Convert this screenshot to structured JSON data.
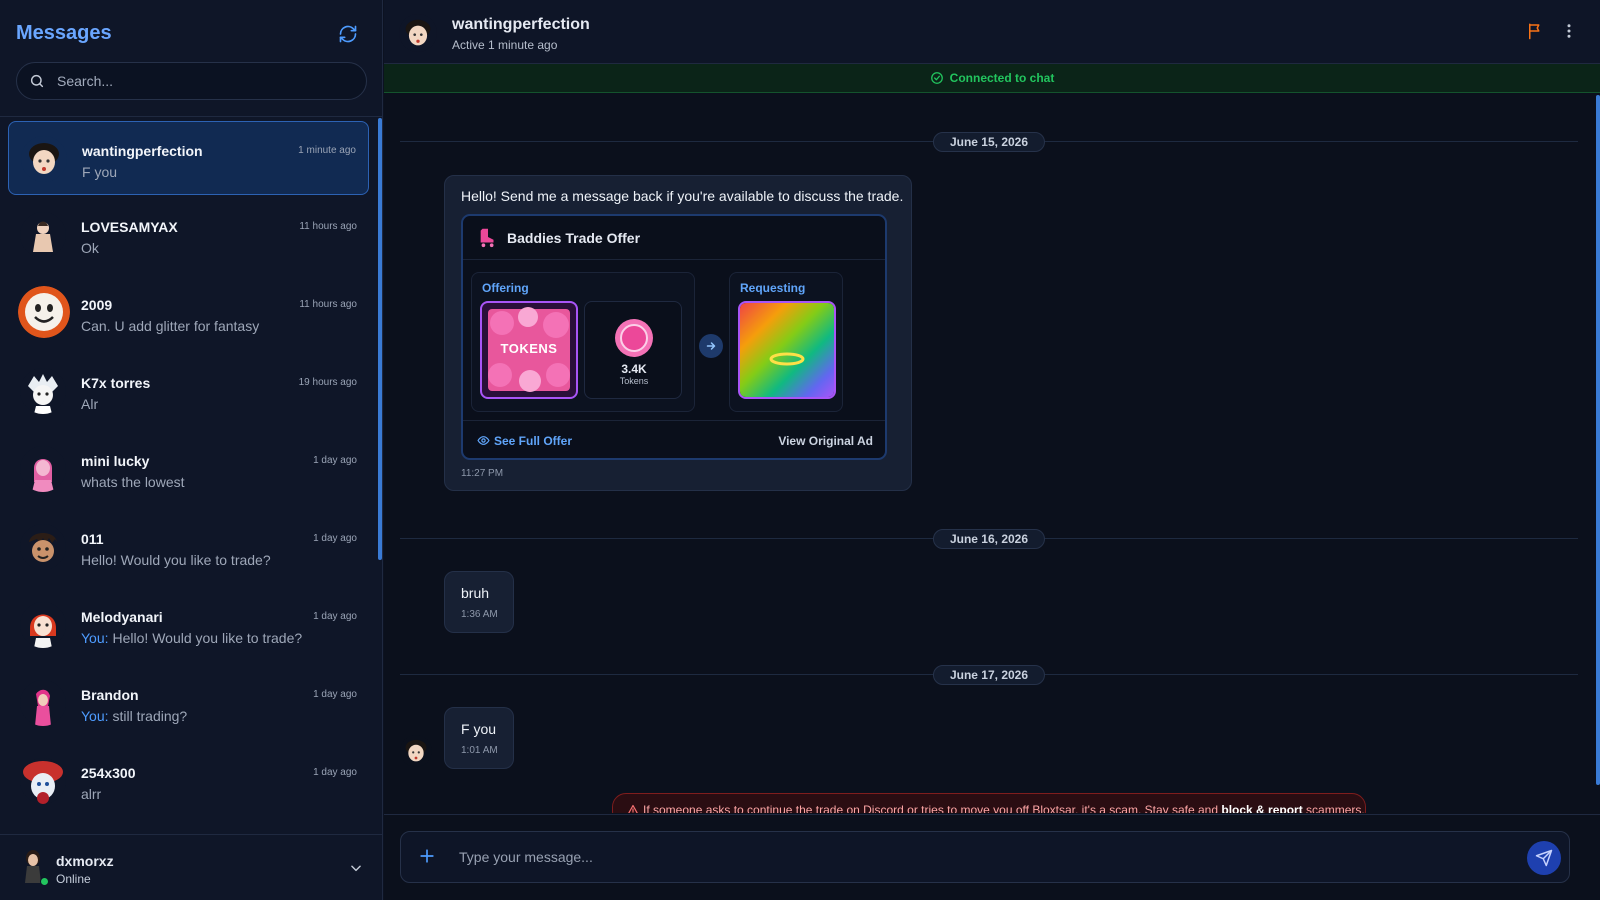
{
  "sidebar": {
    "title": "Messages",
    "search_placeholder": "Search...",
    "conversations": [
      {
        "name": "wantingperfection",
        "time": "1 minute ago",
        "you": "",
        "preview": "F you",
        "active": true
      },
      {
        "name": "LOVESAMYAX",
        "time": "11 hours ago",
        "you": "",
        "preview": "Ok"
      },
      {
        "name": "2009",
        "time": "11 hours ago",
        "you": "",
        "preview": "Can. U add glitter for fantasy"
      },
      {
        "name": "K7x torres",
        "time": "19 hours ago",
        "you": "",
        "preview": "Alr"
      },
      {
        "name": "mini lucky",
        "time": "1 day ago",
        "you": "",
        "preview": "whats the lowest"
      },
      {
        "name": "011",
        "time": "1 day ago",
        "you": "",
        "preview": "Hello! Would you like to trade?"
      },
      {
        "name": "Melodyanari",
        "time": "1 day ago",
        "you": "You:",
        "preview": "Hello! Would you like to trade?"
      },
      {
        "name": "Brandon",
        "time": "1 day ago",
        "you": "You:",
        "preview": "still trading?"
      },
      {
        "name": "254x300",
        "time": "1 day ago",
        "you": "",
        "preview": "alrr"
      }
    ],
    "me": {
      "name": "dxmorxz",
      "status": "Online"
    }
  },
  "header": {
    "name": "wantingperfection",
    "status": "Active 1 minute ago"
  },
  "banner": "Connected to chat",
  "chat": {
    "dates": [
      "June 15, 2026",
      "June 16, 2026",
      "June 17, 2026"
    ],
    "msg1": {
      "text": "Hello! Send me a message back if you're available to discuss the trade.",
      "time": "11:27 PM"
    },
    "trade": {
      "title": "Baddies Trade Offer",
      "offering_label": "Offering",
      "requesting_label": "Requesting",
      "tokens_tile_text": "TOKENS",
      "token_amount": "3.4K",
      "token_unit": "Tokens",
      "see_full": "See Full Offer",
      "view_ad": "View Original Ad"
    },
    "msg2": {
      "text": "bruh",
      "time": "1:36 AM"
    },
    "msg3": {
      "text": "F you",
      "time": "1:01 AM"
    },
    "warning": {
      "pre": "If someone asks to continue the trade on Discord or tries to move you off Bloxtsar, it's a scam. Stay safe and ",
      "bold": "block & report",
      "post": " scammers."
    }
  },
  "composer": {
    "placeholder": "Type your message..."
  },
  "colors": {
    "accent": "#3a7bd5",
    "online": "#22c55e",
    "connected": "#22c55e",
    "warning": "#fca5a5",
    "flag": "#f97316"
  }
}
